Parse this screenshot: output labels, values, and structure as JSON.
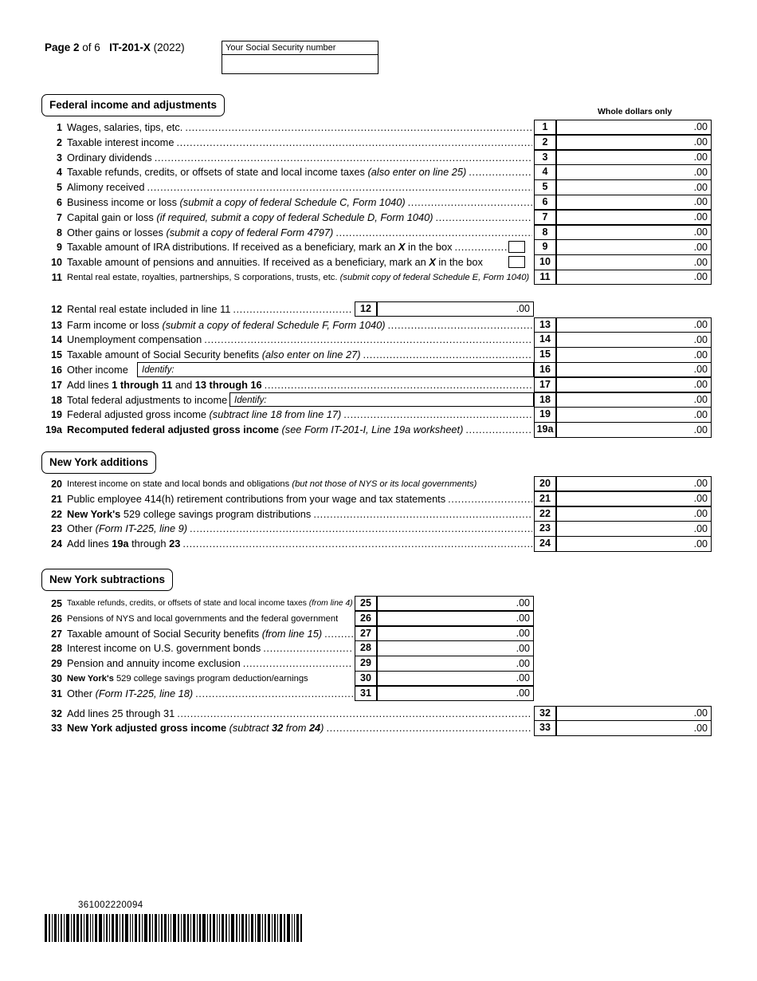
{
  "header": {
    "page_label_bold": "Page 2",
    "page_label_rest": " of 6",
    "form_id": "IT-201-X",
    "form_year": "(2022)",
    "ssn_label": "Your Social Security number",
    "ssn_value": ""
  },
  "columns": {
    "whole_dollars": "Whole dollars only",
    "cents_suffix": ".00"
  },
  "sections": [
    {
      "id": "federal",
      "title": "Federal income and adjustments"
    },
    {
      "id": "additions",
      "title": "New York additions"
    },
    {
      "id": "subtractions",
      "title": "New York subtractions"
    }
  ],
  "federal_lines": [
    {
      "no": "1",
      "text": "Wages, salaries, tips, etc.",
      "note": "",
      "leader": true
    },
    {
      "no": "2",
      "text": "Taxable interest income",
      "note": "",
      "leader": true
    },
    {
      "no": "3",
      "text": "Ordinary dividends",
      "note": "",
      "leader": true
    },
    {
      "no": "4",
      "text": "Taxable refunds, credits, or offsets of state and local income taxes",
      "note": "(also enter on line 25)",
      "leader": true
    },
    {
      "no": "5",
      "text": "Alimony received",
      "note": "",
      "leader": true
    },
    {
      "no": "6",
      "text": "Business income or loss",
      "note": "(submit a copy of federal Schedule C, Form 1040)",
      "leader": true
    },
    {
      "no": "7",
      "text": "Capital gain or loss",
      "note": "(if required, submit a copy of federal Schedule D, Form 1040)",
      "leader": true
    },
    {
      "no": "8",
      "text": "Other gains or losses",
      "note": "(submit a copy of federal Form 4797)",
      "leader": true
    },
    {
      "no": "9",
      "text": "Taxable amount of IRA distributions. If received as a beneficiary, mark an X in the box",
      "note": "",
      "leader": true,
      "checkbox": true
    },
    {
      "no": "10",
      "text": "Taxable amount of pensions and annuities. If received as a beneficiary, mark an X in the box",
      "note": "",
      "leader": false,
      "checkbox": true
    },
    {
      "no": "11",
      "text": "Rental real estate, royalties, partnerships, S corporations, trusts, etc.",
      "note": "(submit copy of federal Schedule E, Form 1040)",
      "leader": false
    },
    {
      "no": "12",
      "text": "Rental real estate included in line 11",
      "note": "",
      "leader": true,
      "inset": true
    },
    {
      "no": "13",
      "text": "Farm income or loss",
      "note": "(submit a copy of federal Schedule F, Form 1040)",
      "leader": true
    },
    {
      "no": "14",
      "text": "Unemployment compensation",
      "note": "",
      "leader": true
    },
    {
      "no": "15",
      "text": "Taxable amount of Social Security benefits",
      "note": "(also enter on line 27)",
      "leader": true
    },
    {
      "no": "16",
      "text": "Other income",
      "note": "",
      "leader": false,
      "identify": "Identify:"
    },
    {
      "no": "17",
      "text": "Add lines 1 through 11 and 13 through 16",
      "note": "",
      "leader": true
    },
    {
      "no": "18",
      "text": "Total federal adjustments to income",
      "note": "",
      "leader": false,
      "identify": "Identify:"
    },
    {
      "no": "19",
      "text": "Federal adjusted gross income",
      "note": "(subtract line 18 from line 17)",
      "leader": true
    },
    {
      "no": "19a",
      "text": "Recomputed federal adjusted gross income",
      "note": "(see Form IT-201-I, Line 19a worksheet)",
      "leader": true,
      "bold": true
    }
  ],
  "addition_lines": [
    {
      "no": "20",
      "text": "Interest income on state and local bonds and obligations",
      "note": "(but not those of NYS or its local governments)",
      "leader": false
    },
    {
      "no": "21",
      "text": "Public employee 414(h) retirement contributions from your wage and tax statements",
      "note": "",
      "leader": true
    },
    {
      "no": "22",
      "text": "New York's 529 college savings program distributions",
      "note": "",
      "leader": true
    },
    {
      "no": "23",
      "text": "Other",
      "note": "(Form IT-225, line 9)",
      "leader": true
    },
    {
      "no": "24",
      "text": "Add lines 19a through 23",
      "note": "",
      "leader": true
    }
  ],
  "subtraction_lines": [
    {
      "no": "25",
      "text": "Taxable refunds, credits, or offsets of state and local income taxes",
      "note": "(from line 4)",
      "leader": false,
      "inset": true
    },
    {
      "no": "26",
      "text": "Pensions of NYS and local governments and the federal government",
      "note": "",
      "leader": false,
      "inset": true
    },
    {
      "no": "27",
      "text": "Taxable amount of Social Security benefits",
      "note": "(from line 15)",
      "leader": true,
      "inset": true
    },
    {
      "no": "28",
      "text": "Interest income on U.S. government bonds",
      "note": "",
      "leader": true,
      "inset": true
    },
    {
      "no": "29",
      "text": "Pension and annuity income exclusion",
      "note": "",
      "leader": true,
      "inset": true
    },
    {
      "no": "30",
      "text": "New York's 529 college savings program deduction/earnings",
      "note": "",
      "leader": false,
      "inset": true
    },
    {
      "no": "31",
      "text": "Other",
      "note": "(Form IT-225, line 18)",
      "leader": true,
      "inset": true
    },
    {
      "no": "32",
      "text": "Add lines 25 through 31",
      "note": "",
      "leader": true
    },
    {
      "no": "33",
      "text": "New York adjusted gross income",
      "note": "(subtract line 32 from line 24)",
      "leader": true,
      "bold": true
    }
  ],
  "footer": {
    "barcode_number": "361002220094"
  }
}
